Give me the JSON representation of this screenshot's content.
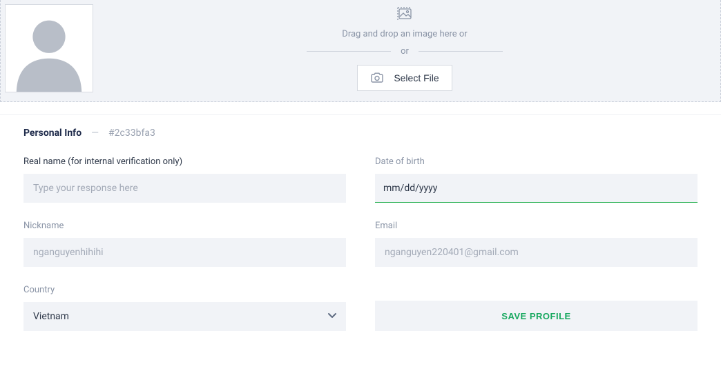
{
  "upload": {
    "drag_text": "Drag and drop an image here or",
    "or_text": "or",
    "select_file_label": "Select File"
  },
  "section": {
    "title": "Personal Info",
    "dash": "—",
    "hash": "#2c33bfa3"
  },
  "fields": {
    "real_name": {
      "label": "Real name (for internal verification only)",
      "placeholder": "Type your response here",
      "value": ""
    },
    "dob": {
      "label": "Date of birth",
      "placeholder": "mm/dd/yyyy",
      "value": ""
    },
    "nickname": {
      "label": "Nickname",
      "placeholder": "nganguyenhihihi",
      "value": ""
    },
    "email": {
      "label": "Email",
      "placeholder": "nganguyen220401@gmail.com",
      "value": ""
    },
    "country": {
      "label": "Country",
      "value": "Vietnam"
    }
  },
  "actions": {
    "save_label": "SAVE PROFILE"
  }
}
